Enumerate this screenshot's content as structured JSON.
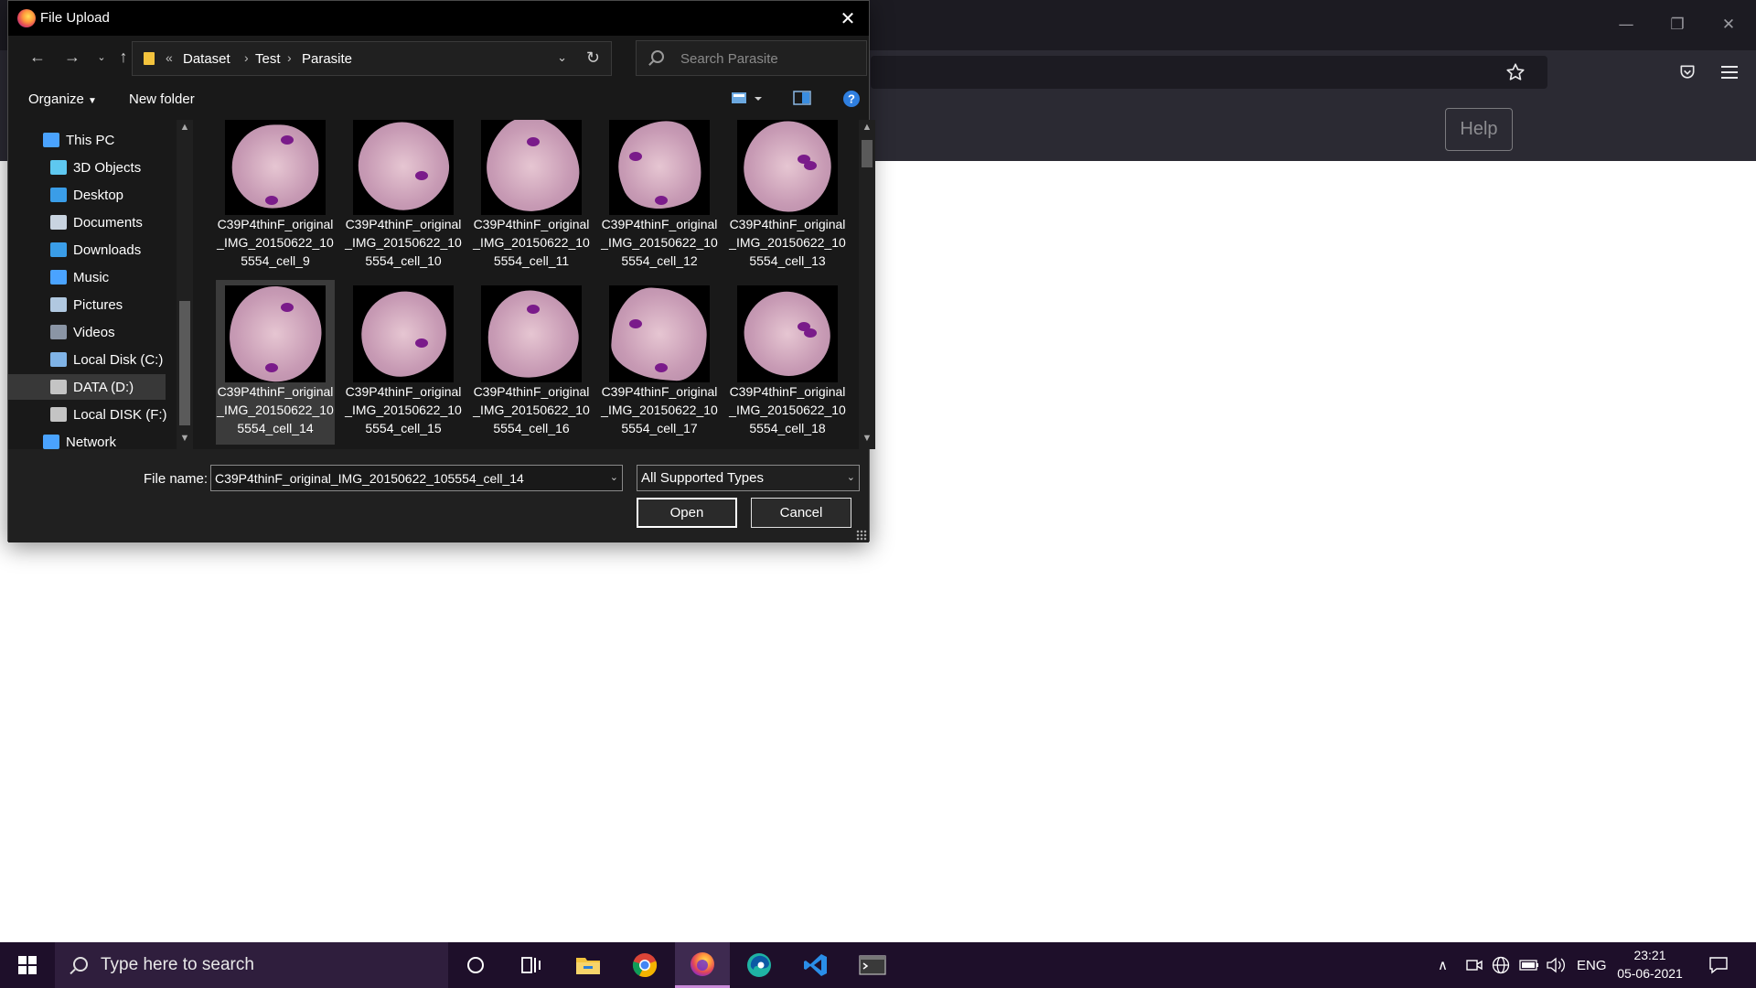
{
  "browser": {
    "help_label": "Help",
    "icons": [
      "minimize-icon",
      "restore-icon",
      "close-icon",
      "bookmark-star-icon",
      "pocket-icon",
      "hamburger-menu-icon"
    ]
  },
  "dialog": {
    "title": "File Upload",
    "breadcrumb": {
      "overflow": "«",
      "items": [
        "Dataset",
        "Test",
        "Parasite"
      ]
    },
    "search_placeholder": "Search Parasite",
    "toolbar": {
      "organize": "Organize",
      "new_folder": "New folder"
    },
    "tree": [
      {
        "label": "This PC",
        "icon": "pc-icon",
        "color": "#4aa3ff",
        "indent": 0
      },
      {
        "label": "3D Objects",
        "icon": "cube-icon",
        "color": "#5ec8f0",
        "indent": 1
      },
      {
        "label": "Desktop",
        "icon": "desktop-icon",
        "color": "#3a9de8",
        "indent": 1
      },
      {
        "label": "Documents",
        "icon": "documents-icon",
        "color": "#c9d4e0",
        "indent": 1
      },
      {
        "label": "Downloads",
        "icon": "download-icon",
        "color": "#3a9de8",
        "indent": 1
      },
      {
        "label": "Music",
        "icon": "music-icon",
        "color": "#4aa3ff",
        "indent": 1
      },
      {
        "label": "Pictures",
        "icon": "pictures-icon",
        "color": "#b0c8e0",
        "indent": 1
      },
      {
        "label": "Videos",
        "icon": "videos-icon",
        "color": "#8a95a5",
        "indent": 1
      },
      {
        "label": "Local Disk (C:)",
        "icon": "windows-drive-icon",
        "color": "#7fb3e6",
        "indent": 1
      },
      {
        "label": "DATA (D:)",
        "icon": "drive-icon",
        "color": "#c4c4c4",
        "indent": 1,
        "selected": true
      },
      {
        "label": "Local DISK (F:)",
        "icon": "drive-icon",
        "color": "#c4c4c4",
        "indent": 1
      },
      {
        "label": "Network",
        "icon": "network-icon",
        "color": "#4aa3ff",
        "indent": 0
      }
    ],
    "files": [
      {
        "name": "C39P4thinF_original_IMG_20150622_105554_cell_9",
        "selected": false
      },
      {
        "name": "C39P4thinF_original_IMG_20150622_105554_cell_10",
        "selected": false
      },
      {
        "name": "C39P4thinF_original_IMG_20150622_105554_cell_11",
        "selected": false
      },
      {
        "name": "C39P4thinF_original_IMG_20150622_105554_cell_12",
        "selected": false
      },
      {
        "name": "C39P4thinF_original_IMG_20150622_105554_cell_13",
        "selected": false
      },
      {
        "name": "C39P4thinF_original_IMG_20150622_105554_cell_14",
        "selected": true
      },
      {
        "name": "C39P4thinF_original_IMG_20150622_105554_cell_15",
        "selected": false
      },
      {
        "name": "C39P4thinF_original_IMG_20150622_105554_cell_16",
        "selected": false
      },
      {
        "name": "C39P4thinF_original_IMG_20150622_105554_cell_17",
        "selected": false
      },
      {
        "name": "C39P4thinF_original_IMG_20150622_105554_cell_18",
        "selected": false
      }
    ],
    "file_name_label": "File name:",
    "file_name_value": "C39P4thinF_original_IMG_20150622_105554_cell_14",
    "file_type": "All Supported Types",
    "open_label": "Open",
    "cancel_label": "Cancel"
  },
  "taskbar": {
    "search_placeholder": "Type here to search",
    "apps": [
      "cortana-icon",
      "task-view-icon",
      "file-explorer-icon",
      "chrome-icon",
      "firefox-icon",
      "edge-icon",
      "vscode-icon",
      "terminal-icon"
    ],
    "active_app": "firefox-icon",
    "language": "ENG",
    "time": "23:21",
    "date": "05-06-2021"
  },
  "colors": {
    "dialog_bg": "#191919",
    "selection": "#3b3b3b",
    "taskbar_bg": "#1e0f2a",
    "cell_stain": "#c79ab4",
    "parasite_dot": "#7a1b8a"
  }
}
